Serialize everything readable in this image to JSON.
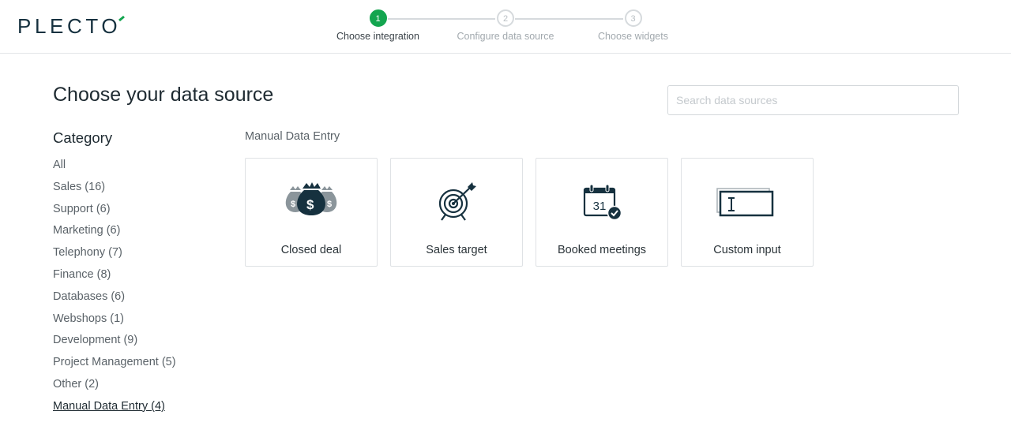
{
  "brand": {
    "logo_text": "PLECTO"
  },
  "stepper": {
    "steps": [
      {
        "number": "1",
        "label": "Choose integration",
        "active": true
      },
      {
        "number": "2",
        "label": "Configure data source",
        "active": false
      },
      {
        "number": "3",
        "label": "Choose widgets",
        "active": false
      }
    ]
  },
  "main": {
    "title": "Choose your data source",
    "search": {
      "placeholder": "Search data sources",
      "value": ""
    }
  },
  "sidebar": {
    "title": "Category",
    "items": [
      {
        "label": "All"
      },
      {
        "label": "Sales (16)"
      },
      {
        "label": "Support (6)"
      },
      {
        "label": "Marketing (6)"
      },
      {
        "label": "Telephony (7)"
      },
      {
        "label": "Finance (8)"
      },
      {
        "label": "Databases (6)"
      },
      {
        "label": "Webshops (1)"
      },
      {
        "label": "Development (9)"
      },
      {
        "label": "Project Management (5)"
      },
      {
        "label": "Other (2)"
      },
      {
        "label": "Manual Data Entry (4)",
        "selected": true
      }
    ]
  },
  "section": {
    "label": "Manual Data Entry",
    "cards": [
      {
        "label": "Closed deal",
        "icon": "money-bags-icon"
      },
      {
        "label": "Sales target",
        "icon": "target-icon"
      },
      {
        "label": "Booked meetings",
        "icon": "calendar-check-icon",
        "date": "31"
      },
      {
        "label": "Custom input",
        "icon": "text-input-icon"
      }
    ]
  },
  "colors": {
    "accent_green": "#13a54f",
    "icon_dark": "#16313f",
    "icon_gray": "#8b959b"
  }
}
